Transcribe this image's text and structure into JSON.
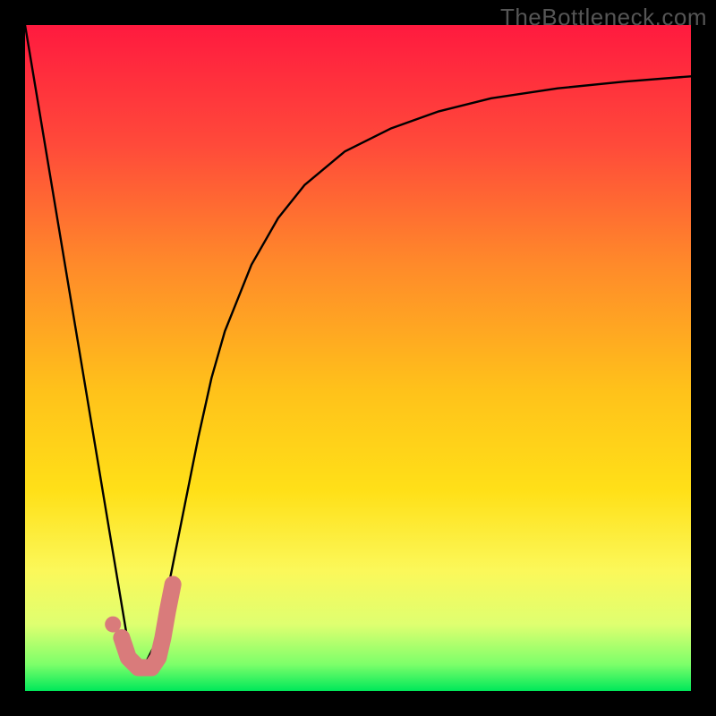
{
  "watermark": "TheBottleneck.com",
  "chart_data": {
    "type": "line",
    "title": "",
    "xlabel": "",
    "ylabel": "",
    "xlim": [
      0,
      100
    ],
    "ylim": [
      0,
      100
    ],
    "background": "vertical-gradient red-to-orange-to-yellow-to-green",
    "series": [
      {
        "name": "left-arm",
        "color": "#000000",
        "x": [
          0,
          16
        ],
        "values": [
          100,
          4
        ]
      },
      {
        "name": "right-arm",
        "color": "#000000",
        "x": [
          18,
          20,
          22,
          24,
          26,
          28,
          30,
          34,
          38,
          42,
          48,
          55,
          62,
          70,
          80,
          90,
          100
        ],
        "values": [
          4,
          8,
          18,
          28,
          38,
          47,
          54,
          64,
          71,
          76,
          81,
          84.5,
          87,
          89,
          90.5,
          91.5,
          92.3
        ]
      },
      {
        "name": "j-stroke-highlight",
        "color": "#d97b7b",
        "x": [
          14.5,
          15.5,
          17,
          19,
          20,
          20.7,
          21.4,
          22.2
        ],
        "values": [
          8,
          5,
          3.5,
          3.5,
          5,
          8,
          12,
          16
        ]
      },
      {
        "name": "dot",
        "type": "scatter",
        "color": "#d97b7b",
        "x": [
          13.2
        ],
        "values": [
          10
        ]
      }
    ],
    "gradient_stops": [
      {
        "offset": 0.0,
        "color": "#ff1a3f"
      },
      {
        "offset": 0.18,
        "color": "#ff4a3a"
      },
      {
        "offset": 0.36,
        "color": "#ff8a2a"
      },
      {
        "offset": 0.55,
        "color": "#ffc21a"
      },
      {
        "offset": 0.7,
        "color": "#ffe018"
      },
      {
        "offset": 0.82,
        "color": "#fbf85a"
      },
      {
        "offset": 0.9,
        "color": "#dfff70"
      },
      {
        "offset": 0.96,
        "color": "#7dff6a"
      },
      {
        "offset": 1.0,
        "color": "#00e85a"
      }
    ]
  }
}
